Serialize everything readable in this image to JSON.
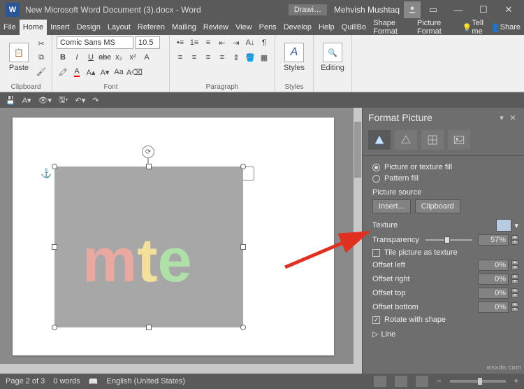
{
  "title": "New Microsoft Word Document (3).docx - Word",
  "drawing_tools": "Drawi…",
  "user": "Mehvish Mushtaq",
  "tabs": [
    "File",
    "Home",
    "Insert",
    "Design",
    "Layout",
    "Referen",
    "Mailing",
    "Review",
    "View",
    "Pens",
    "Develop",
    "Help",
    "QuillBo",
    "Shape Format",
    "Picture Format"
  ],
  "active_tab": "Home",
  "tell_me": "Tell me",
  "share": "Share",
  "ribbon": {
    "clipboard": {
      "label": "Clipboard",
      "paste": "Paste"
    },
    "font": {
      "label": "Font",
      "name": "Comic Sans MS",
      "size": "10.5",
      "bold": "B",
      "italic": "I",
      "underline": "U",
      "strike": "abc"
    },
    "paragraph": {
      "label": "Paragraph"
    },
    "styles": {
      "label": "Styles",
      "btn": "Styles"
    },
    "editing": {
      "label": "",
      "btn": "Editing"
    }
  },
  "content": {
    "m": "m",
    "t": "t",
    "e": "e"
  },
  "panel": {
    "title": "Format Picture",
    "picture_or_texture": "Picture or texture fill",
    "pattern_fill": "Pattern fill",
    "picture_source": "Picture source",
    "insert": "Insert...",
    "clipboard": "Clipboard",
    "texture": "Texture",
    "transparency": "Transparency",
    "transparency_val": "57%",
    "transparency_pct": 57,
    "tile": "Tile picture as texture",
    "offset_left": "Offset left",
    "offset_left_v": "0%",
    "offset_right": "Offset right",
    "offset_right_v": "0%",
    "offset_top": "Offset top",
    "offset_top_v": "0%",
    "offset_bottom": "Offset bottom",
    "offset_bottom_v": "0%",
    "rotate": "Rotate with shape",
    "line": "Line"
  },
  "status": {
    "page": "Page 2 of 3",
    "words": "0 words",
    "lang": "English (United States)",
    "zoom_minus": "−",
    "zoom_plus": "+"
  },
  "watermark": "wsxdn.com"
}
